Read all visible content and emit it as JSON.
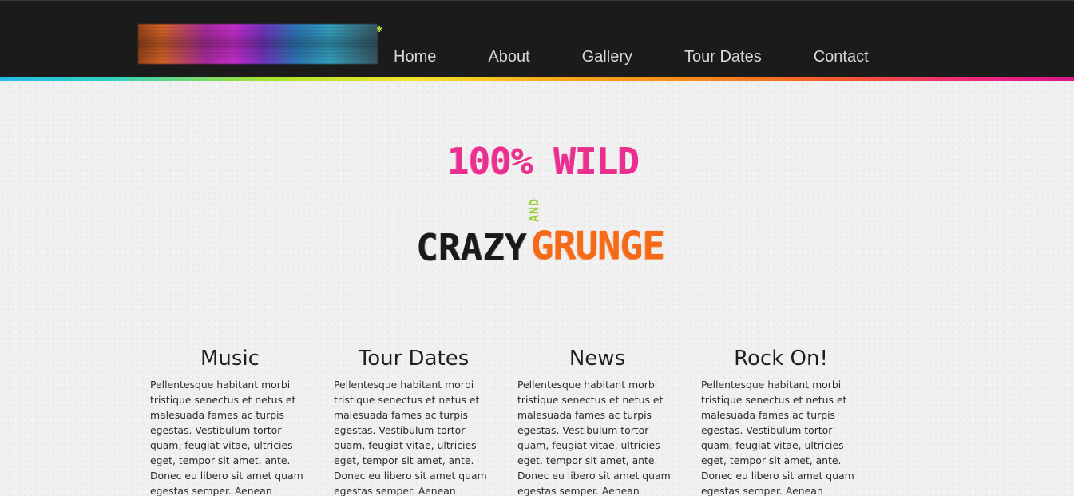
{
  "header": {
    "logo_name": "site-logo",
    "nav": [
      {
        "label": "Home"
      },
      {
        "label": "About"
      },
      {
        "label": "Gallery"
      },
      {
        "label": "Tour Dates"
      },
      {
        "label": "Contact"
      }
    ]
  },
  "hero": {
    "line1": "100% WILD",
    "and": "AND",
    "crazy": "CRAZY",
    "grunge": "GRUNGE"
  },
  "columns": [
    {
      "title": "Music",
      "text": "Pellentesque habitant morbi tristique senectus et netus et malesuada fames ac turpis egestas. Vestibulum tortor quam, feugiat vitae, ultricies eget, tempor sit amet, ante. Donec eu libero sit amet quam egestas semper. Aenean ultricies mi vitae"
    },
    {
      "title": "Tour Dates",
      "text": "Pellentesque habitant morbi tristique senectus et netus et malesuada fames ac turpis egestas. Vestibulum tortor quam, feugiat vitae, ultricies eget, tempor sit amet, ante. Donec eu libero sit amet quam egestas semper. Aenean ultricies mi vitae"
    },
    {
      "title": "News",
      "text": "Pellentesque habitant morbi tristique senectus et netus et malesuada fames ac turpis egestas. Vestibulum tortor quam, feugiat vitae, ultricies eget, tempor sit amet, ante. Donec eu libero sit amet quam egestas semper. Aenean ultricies mi vitae"
    },
    {
      "title": "Rock On!",
      "text": "Pellentesque habitant morbi tristique senectus et netus et malesuada fames ac turpis egestas. Vestibulum tortor quam, feugiat vitae, ultricies eget, tempor sit amet, ante. Donec eu libero sit amet quam egestas semper. Aenean ultricies mi vitae"
    }
  ],
  "colors": {
    "header_bg": "#1b1b1b",
    "nav_text": "#d8d8d8",
    "page_bg": "#f0f0f0",
    "hero_pink": "#ea2f8e",
    "hero_green": "#98cf3a",
    "hero_black": "#1a1a1a",
    "hero_orange": "#f56a16"
  }
}
